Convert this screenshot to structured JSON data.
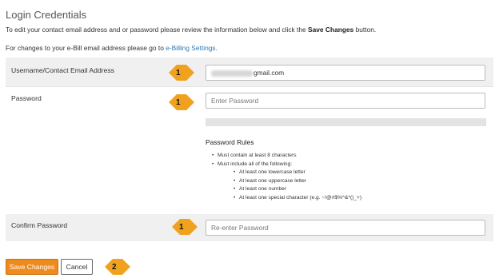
{
  "section_title": "Login Credentials",
  "intro": {
    "prefix": "To edit your contact email address and or password please review the information below and click the ",
    "bold": "Save Changes",
    "suffix": " button."
  },
  "changes_note": {
    "prefix": "For changes to your e-Bill email address please go to ",
    "link": "e-Billing Settings",
    "suffix": "."
  },
  "username": {
    "label": "Username/Contact Email Address",
    "value_visible_suffix": "gmail.com"
  },
  "password": {
    "label": "Password",
    "placeholder": "Enter Password"
  },
  "rules": {
    "title": "Password Rules",
    "items": [
      "Must contain at least 8 characters",
      "Must include all of the following:"
    ],
    "sub_items": [
      "At least one lowercase letter",
      "At least one uppercase letter",
      "At least one number",
      "At least one special character (e.g. ~!@#$%^&*()_+)"
    ]
  },
  "confirm": {
    "label": "Confirm Password",
    "placeholder": "Re-enter Password"
  },
  "buttons": {
    "save": "Save Changes",
    "cancel": "Cancel"
  },
  "callouts": {
    "one": "1",
    "two": "2"
  },
  "colors": {
    "accent": "#ee8b1c",
    "callout": "#f0a21f",
    "link": "#2a7ab8"
  }
}
